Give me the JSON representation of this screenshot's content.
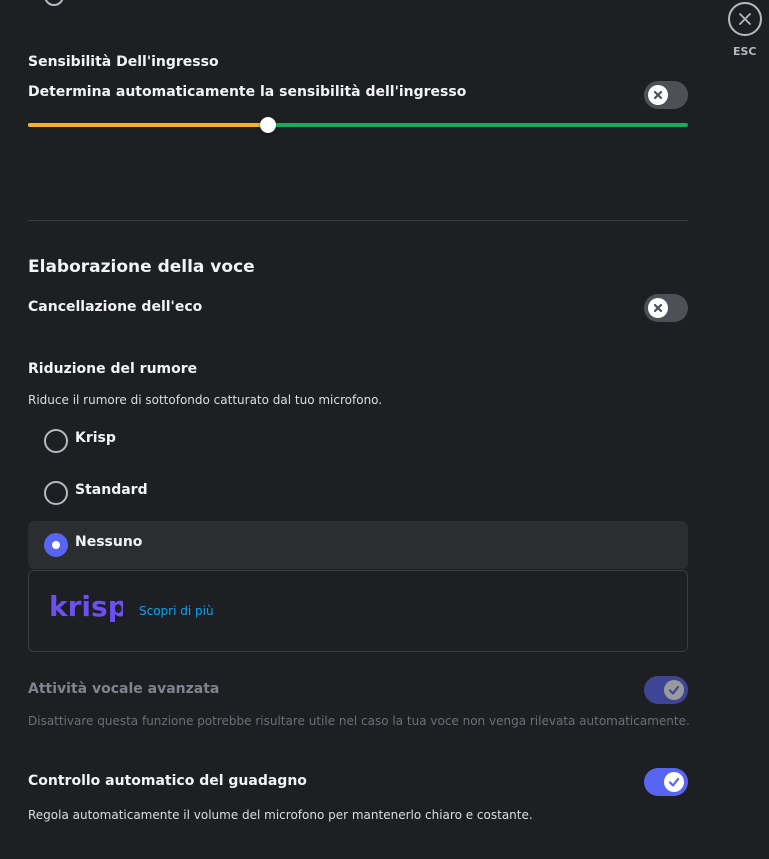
{
  "close": {
    "label": "ESC"
  },
  "input_sensitivity": {
    "title": "Sensibilità Dell'ingresso",
    "auto_label": "Determina automaticamente la sensibilità dell'ingresso",
    "auto_enabled": false,
    "slider_value_fraction": 0.364,
    "colors": {
      "below": "#f0b232",
      "above": "#23a55a"
    }
  },
  "voice_processing": {
    "title": "Elaborazione della voce",
    "echo_cancellation": {
      "label": "Cancellazione dell'eco",
      "enabled": false
    },
    "noise_reduction": {
      "title": "Riduzione del rumore",
      "description": "Riduce il rumore di sottofondo catturato dal tuo microfono.",
      "options": [
        {
          "label": "Krisp",
          "selected": false
        },
        {
          "label": "Standard",
          "selected": false
        },
        {
          "label": "Nessuno",
          "selected": true
        }
      ],
      "krisp_logo_text": "krisp",
      "learn_more": "Scopri di più"
    },
    "advanced_voice_activity": {
      "label": "Attività vocale avanzata",
      "description": "Disattivare questa funzione potrebbe risultare utile nel caso la tua voce non venga rilevata automaticamente.",
      "enabled": true,
      "disabled_state": true
    },
    "automatic_gain_control": {
      "label": "Controllo automatico del guadagno",
      "description": "Regola automaticamente il volume del microfono per mantenerlo chiaro e costante.",
      "enabled": true
    }
  },
  "colors": {
    "accent": "#5865f2",
    "background": "#1e1f22",
    "link": "#00a8fc",
    "krisp_brand": "#6e4ff2"
  }
}
